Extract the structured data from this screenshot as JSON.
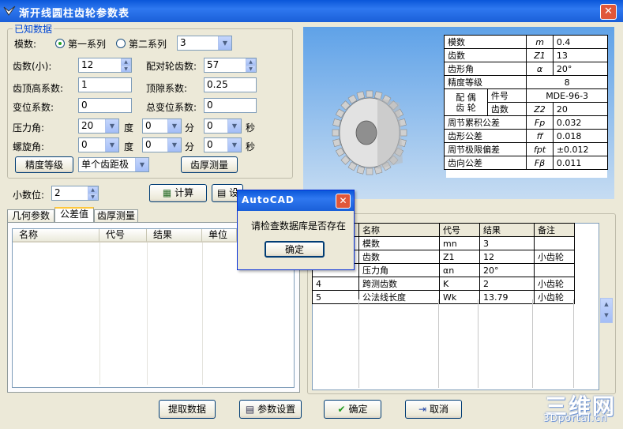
{
  "window": {
    "title": "渐开线圆柱齿轮参数表"
  },
  "known": {
    "group_title": "已知数据",
    "module_label": "模数:",
    "series1": "第一系列",
    "series2": "第二系列",
    "module_value": "3",
    "teeth_label": "齿数(小):",
    "teeth_value": "12",
    "mate_label": "配对轮齿数:",
    "mate_value": "57",
    "addendum_label": "齿顶高系数:",
    "addendum_value": "1",
    "clearance_label": "顶隙系数:",
    "clearance_value": "0.25",
    "shift_label": "变位系数:",
    "shift_value": "0",
    "total_shift_label": "总变位系数:",
    "total_shift_value": "0",
    "pressure_label": "压力角:",
    "pressure_deg": "20",
    "pressure_min": "0",
    "pressure_sec": "0",
    "helix_label": "螺旋角:",
    "helix_deg": "0",
    "helix_min": "0",
    "helix_sec": "0",
    "deg_unit": "度",
    "min_unit": "分",
    "sec_unit": "秒",
    "precision_button": "精度等级",
    "pitch_select": "单个齿距极",
    "thickness_button": "齿厚测量"
  },
  "decimals": {
    "label": "小数位:",
    "value": "2"
  },
  "actions": {
    "calc_button": "计算",
    "second_button": "设"
  },
  "tabs": [
    {
      "label": "几何参数"
    },
    {
      "label": "公差值"
    },
    {
      "label": "齿厚测量"
    }
  ],
  "left_list": {
    "headers": [
      "名称",
      "代号",
      "结果",
      "单位"
    ]
  },
  "spec_table": {
    "rows": [
      [
        "模数",
        "m",
        "0.4"
      ],
      [
        "齿数",
        "Z1",
        "13"
      ],
      [
        "齿形角",
        "α",
        "20°"
      ]
    ],
    "precision": [
      "精度等级",
      "8"
    ],
    "mate_label": "配 偶\n齿 轮",
    "mate_rows": [
      [
        "件号",
        "MDE-96-3"
      ],
      [
        "齿数",
        "Z2",
        "20"
      ]
    ],
    "tol_rows": [
      [
        "周节累积公差",
        "Fp",
        "0.032"
      ],
      [
        "齿形公差",
        "ff",
        "0.018"
      ],
      [
        "周节极限偏差",
        "fpt",
        "±0.012"
      ],
      [
        "齿向公差",
        "Fβ",
        "0.011"
      ]
    ]
  },
  "result_grid": {
    "headers": [
      "",
      "名称",
      "代号",
      "结果",
      "备注"
    ],
    "rows": [
      [
        "",
        "模数",
        "mn",
        "3",
        ""
      ],
      [
        "",
        "齿数",
        "Z1",
        "12",
        "小齿轮"
      ],
      [
        "",
        "压力角",
        "αn",
        "20°",
        ""
      ],
      [
        "4",
        "跨测齿数",
        "K",
        "2",
        "小齿轮"
      ],
      [
        "5",
        "公法线长度",
        "Wk",
        "13.79",
        "小齿轮"
      ]
    ]
  },
  "bottom_buttons": {
    "extract": "提取数据",
    "settings": "参数设置",
    "ok": "确定",
    "cancel": "取消"
  },
  "dialog": {
    "title": "AutoCAD",
    "message": "请检查数据库是否存在",
    "ok": "确定"
  },
  "watermark": {
    "logo": "三维网",
    "url": "3Dportal.cn"
  }
}
